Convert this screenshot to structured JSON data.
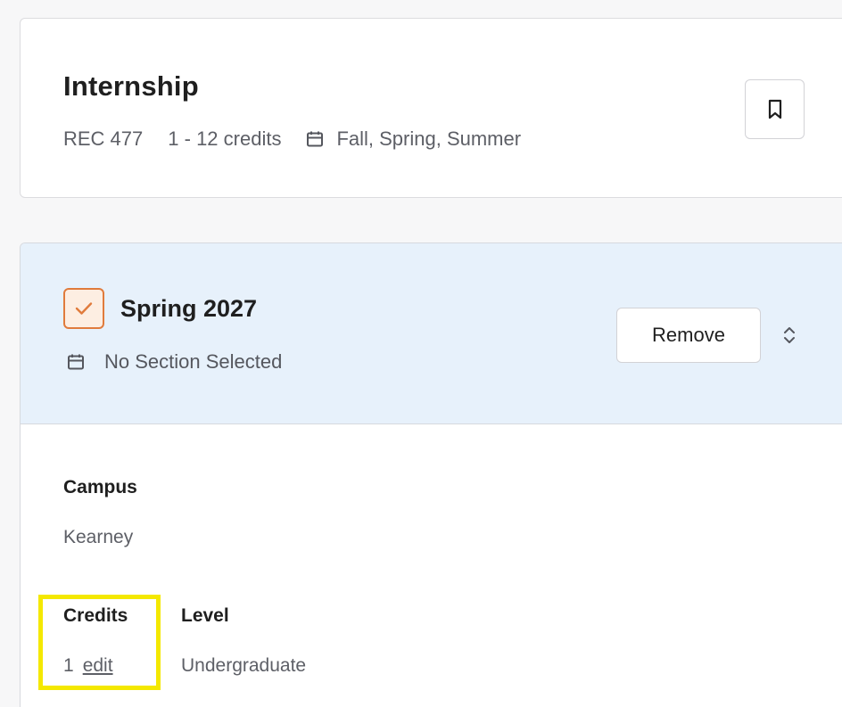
{
  "course": {
    "title": "Internship",
    "code": "REC 477",
    "credits": "1 - 12 credits",
    "terms_offered": "Fall, Spring, Summer"
  },
  "plan": {
    "term": "Spring 2027",
    "section_status": "No Section Selected",
    "remove_label": "Remove",
    "details": {
      "campus_label": "Campus",
      "campus_value": "Kearney",
      "credits_label": "Credits",
      "credits_value": "1",
      "credits_edit": "edit",
      "level_label": "Level",
      "level_value": "Undergraduate"
    }
  },
  "colors": {
    "accent_orange": "#e07b3c",
    "header_blue": "#e7f1fb",
    "highlight_yellow": "#f4e800"
  },
  "icons": [
    "bookmark-icon",
    "calendar-icon",
    "checkmark-icon",
    "chevron-up-down-icon"
  ]
}
